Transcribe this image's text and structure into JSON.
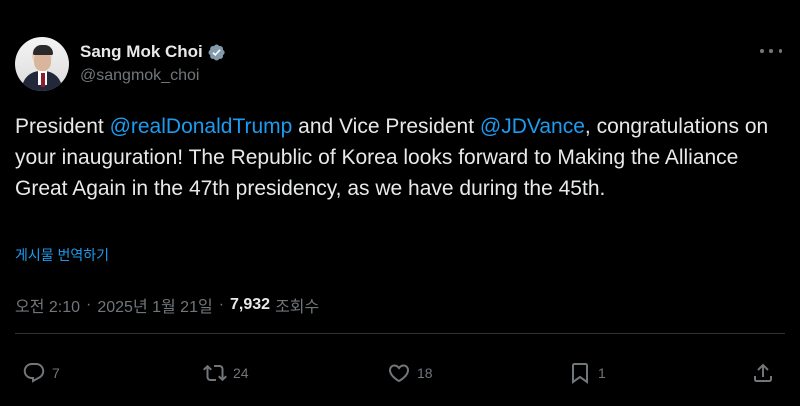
{
  "author": {
    "display_name": "Sang Mok Choi",
    "handle": "@sangmok_choi",
    "verified": true
  },
  "tweet": {
    "text_parts": [
      {
        "text": "President ",
        "type": "text"
      },
      {
        "text": "@realDonaldTrump",
        "type": "mention"
      },
      {
        "text": " and Vice President ",
        "type": "text"
      },
      {
        "text": "@JDVance",
        "type": "mention"
      },
      {
        "text": ", congratulations on your inauguration! The Republic of Korea looks forward to Making the Alliance Great Again in the 47th presidency, as we have during the 45th.",
        "type": "text"
      }
    ],
    "translate_label": "게시물 번역하기",
    "time": "오전 2:10",
    "date": "2025년 1월 21일",
    "views_count": "7,932",
    "views_label": "조회수"
  },
  "actions": {
    "replies": "7",
    "reposts": "24",
    "likes": "18",
    "bookmarks": "1"
  },
  "colors": {
    "background": "#000000",
    "text": "#e7e9ea",
    "secondary": "#71767b",
    "accent": "#1d9bf0"
  },
  "icons": [
    "verified-badge-icon",
    "more-icon",
    "reply-icon",
    "repost-icon",
    "like-icon",
    "bookmark-icon",
    "share-icon"
  ]
}
